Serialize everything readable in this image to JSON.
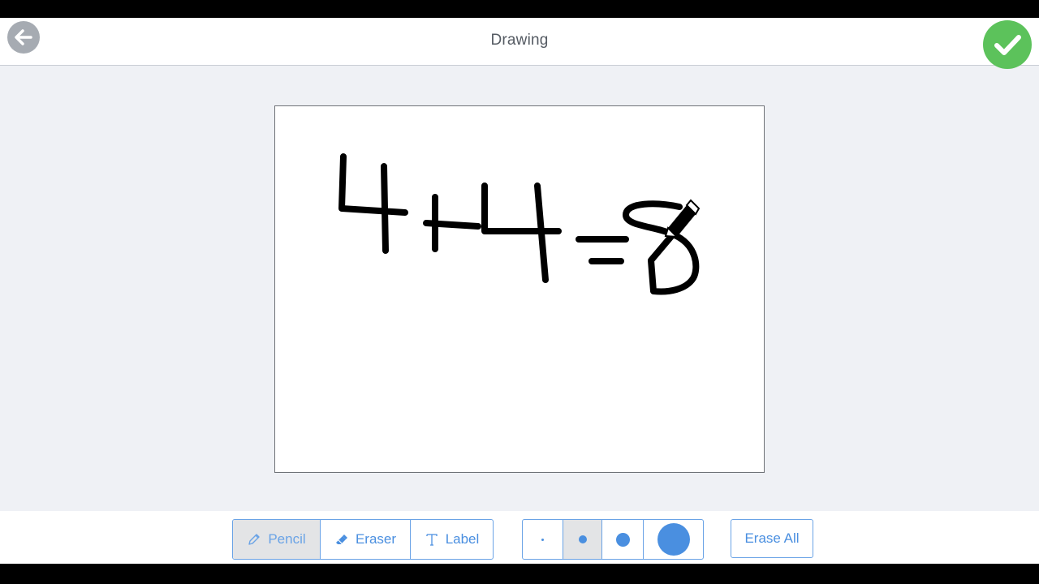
{
  "header": {
    "title": "Drawing",
    "back_icon": "arrow-left-icon",
    "done_icon": "checkmark-icon"
  },
  "colors": {
    "accent": "#4a8fe0",
    "done": "#5cc25b",
    "back": "#a6abb2",
    "ink": "#000000"
  },
  "toolbar": {
    "tools": [
      {
        "label": "Pencil",
        "icon": "pencil-icon",
        "active": true
      },
      {
        "label": "Eraser",
        "icon": "eraser-icon",
        "active": false
      },
      {
        "label": "Label",
        "icon": "text-icon",
        "active": false
      }
    ],
    "brush_sizes": [
      "extra-small",
      "small",
      "medium",
      "large"
    ],
    "selected_brush_size": "small",
    "erase_all_label": "Erase All"
  },
  "canvas": {
    "content": "handwritten strokes"
  }
}
